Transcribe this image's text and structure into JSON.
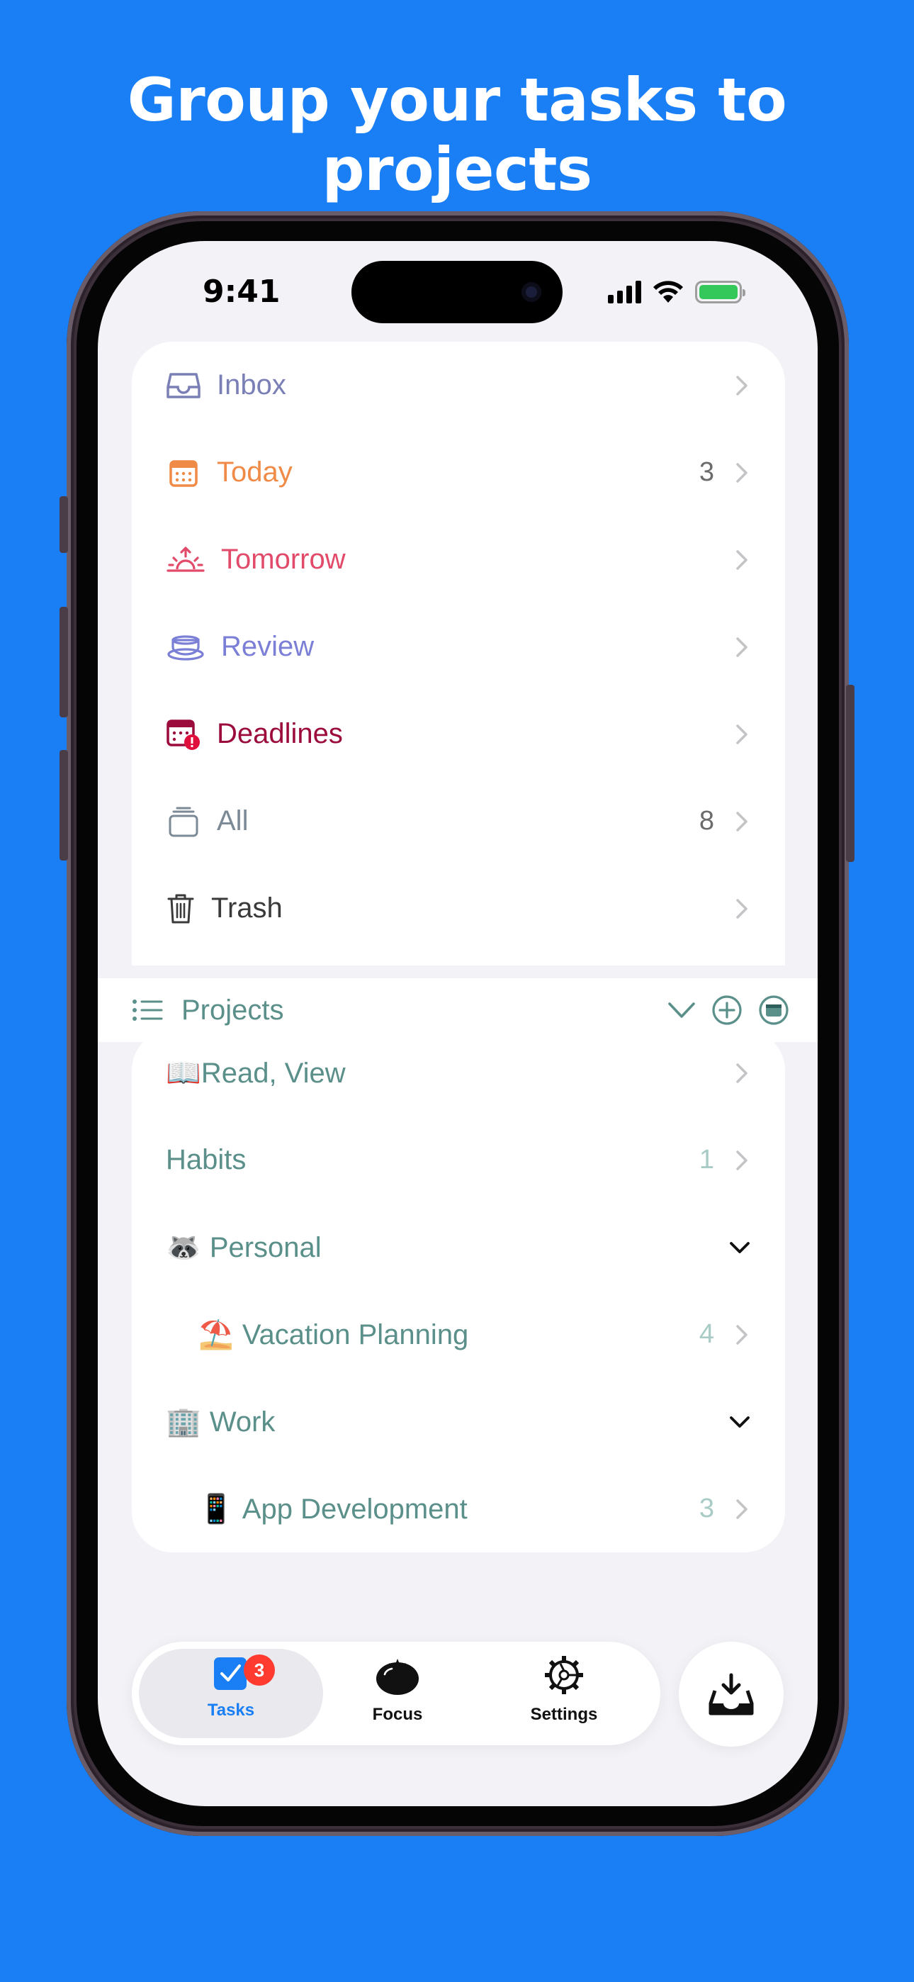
{
  "headline": "Group your tasks to projects",
  "status_bar": {
    "time": "9:41"
  },
  "smart_lists": [
    {
      "label": "Inbox",
      "count": "",
      "color": "#7a7fb5",
      "icon": "inbox-tray-icon"
    },
    {
      "label": "Today",
      "count": "3",
      "color": "#f08a47",
      "icon": "calendar-icon"
    },
    {
      "label": "Tomorrow",
      "count": "",
      "color": "#e24a6a",
      "icon": "sunrise-icon"
    },
    {
      "label": "Review",
      "count": "",
      "color": "#7b7fd6",
      "icon": "cup-icon"
    },
    {
      "label": "Deadlines",
      "count": "",
      "color": "#9b0c3c",
      "icon": "calendar-alert-icon"
    },
    {
      "label": "All",
      "count": "8",
      "color": "#7b8a96",
      "icon": "stack-icon"
    },
    {
      "label": "Trash",
      "count": "",
      "color": "#3a3a3a",
      "icon": "trash-icon"
    }
  ],
  "projects_header": {
    "label": "Projects"
  },
  "projects": [
    {
      "emoji": "📖",
      "label": "Read, View",
      "count": "",
      "indent": false,
      "expand": "chevron-right"
    },
    {
      "emoji": "",
      "label": "Habits",
      "count": "1",
      "indent": false,
      "expand": "chevron-right"
    },
    {
      "emoji": "🦝",
      "label": "Personal",
      "count": "",
      "indent": false,
      "expand": "chevron-down"
    },
    {
      "emoji": "⛱️",
      "label": "Vacation Planning",
      "count": "4",
      "indent": true,
      "expand": "chevron-right"
    },
    {
      "emoji": "🏢",
      "label": "Work",
      "count": "",
      "indent": false,
      "expand": "chevron-down"
    },
    {
      "emoji": "📱",
      "label": "App Development",
      "count": "3",
      "indent": true,
      "expand": "chevron-right"
    }
  ],
  "tabs": [
    {
      "label": "Tasks",
      "badge": "3",
      "active": true,
      "color": "#1a7ff5"
    },
    {
      "label": "Focus",
      "badge": "",
      "active": false
    },
    {
      "label": "Settings",
      "badge": "",
      "active": false
    }
  ],
  "colors": {
    "background": "#1a7ff5",
    "accent": "#1a7ff5",
    "project_text": "#5a8f8a",
    "badge": "#ff3b30"
  }
}
